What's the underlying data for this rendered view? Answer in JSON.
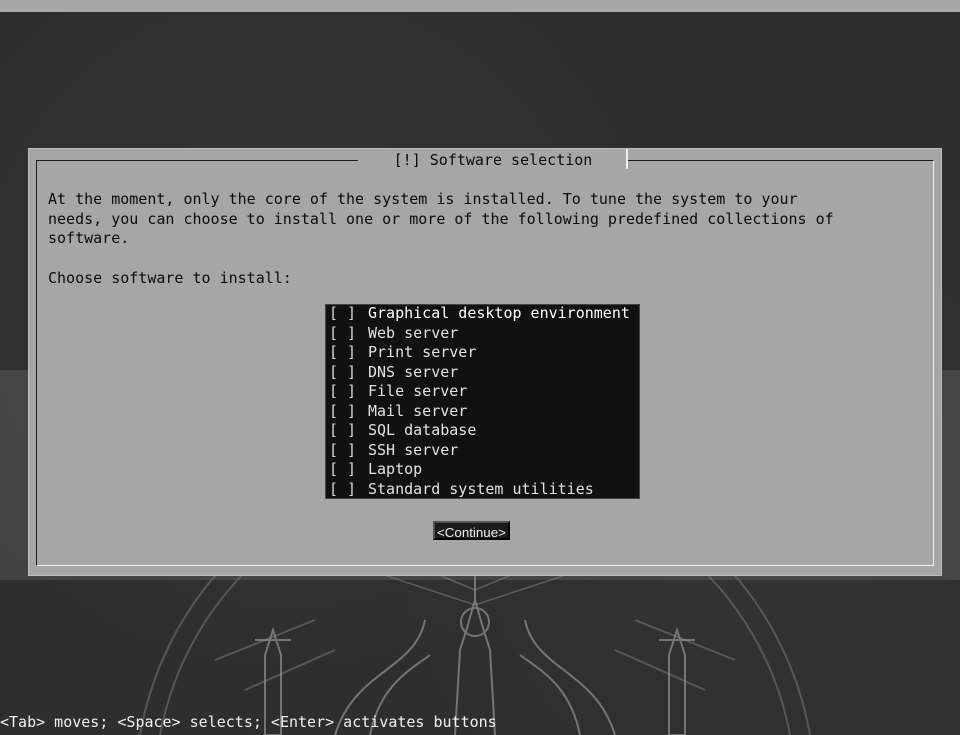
{
  "installer": {
    "dialog_title": "[!] Software selection",
    "intro_text": "At the moment, only the core of the system is installed. To tune the system to your\nneeds, you can choose to install one or more of the following predefined collections of\nsoftware.",
    "prompt": "Choose software to install:",
    "items": [
      {
        "checkbox": "[ ]",
        "label": "Graphical desktop environment"
      },
      {
        "checkbox": "[ ]",
        "label": "Web server"
      },
      {
        "checkbox": "[ ]",
        "label": "Print server"
      },
      {
        "checkbox": "[ ]",
        "label": "DNS server"
      },
      {
        "checkbox": "[ ]",
        "label": "File server"
      },
      {
        "checkbox": "[ ]",
        "label": "Mail server"
      },
      {
        "checkbox": "[ ]",
        "label": "SQL database"
      },
      {
        "checkbox": "[ ]",
        "label": "SSH server"
      },
      {
        "checkbox": "[ ]",
        "label": "Laptop"
      },
      {
        "checkbox": "[ ]",
        "label": "Standard system utilities"
      }
    ],
    "continue_label": "<Continue>",
    "footer_hint": "<Tab> moves; <Space> selects; <Enter> activates buttons"
  },
  "colors": {
    "dialog_bg": "#a6a6a6",
    "list_bg": "#111111",
    "list_fg": "#e2e2e2",
    "screen_bg": "#2e2e2e"
  }
}
